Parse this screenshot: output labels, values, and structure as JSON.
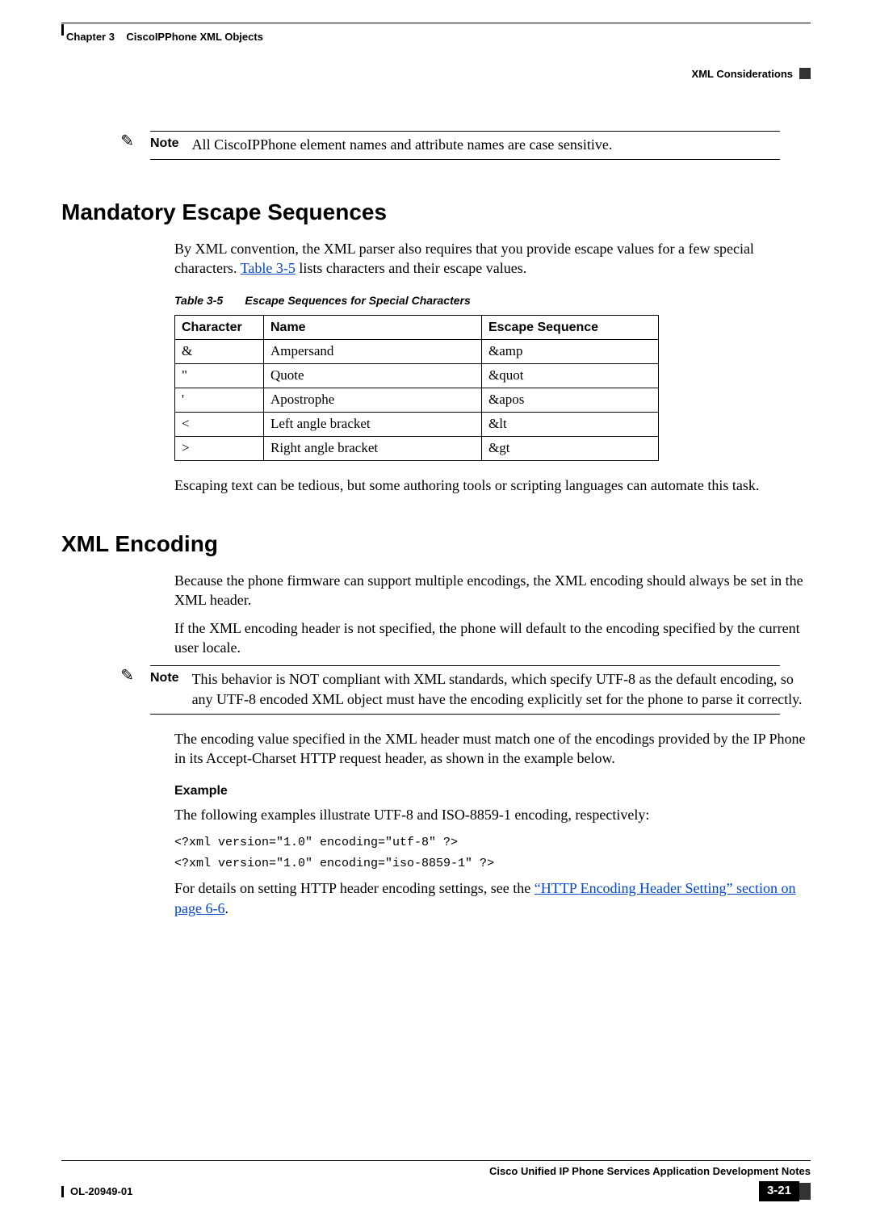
{
  "header": {
    "chapter_label": "Chapter 3",
    "chapter_title": "CiscoIPPhone XML Objects",
    "right_sub": "XML Considerations"
  },
  "note1": {
    "label": "Note",
    "text": "All CiscoIPPhone element names and attribute names are case sensitive."
  },
  "section1": {
    "heading": "Mandatory Escape Sequences",
    "intro_pre": "By XML convention, the XML parser also requires that you provide escape values for a few special characters. ",
    "intro_link": "Table 3-5",
    "intro_post": " lists characters and their escape values.",
    "table_caption_a": "Table 3-5",
    "table_caption_b": "Escape Sequences for Special Characters",
    "cols": {
      "c1": "Character",
      "c2": "Name",
      "c3": "Escape Sequence"
    },
    "rows": [
      {
        "char": "&",
        "name": "Ampersand",
        "seq": "&amp"
      },
      {
        "char": "\"",
        "name": "Quote",
        "seq": "&quot"
      },
      {
        "char": "'",
        "name": "Apostrophe",
        "seq": "&apos"
      },
      {
        "char": "<",
        "name": "Left angle bracket",
        "seq": "&lt"
      },
      {
        "char": ">",
        "name": "Right angle bracket",
        "seq": "&gt"
      }
    ],
    "outro": "Escaping text can be tedious, but some authoring tools or scripting languages can automate this task."
  },
  "section2": {
    "heading": "XML Encoding",
    "p1": "Because the phone firmware can support multiple encodings, the XML encoding should always be set in the XML header.",
    "p2": "If the XML encoding header is not specified, the phone will default to the encoding specified by the current user locale.",
    "note": {
      "label": "Note",
      "text": "This behavior is NOT compliant with XML standards, which specify UTF-8 as the default encoding, so any UTF-8 encoded XML object must have the encoding explicitly set for the phone to parse it correctly."
    },
    "p3": "The encoding value specified in the XML header must match one of the encodings provided by the IP Phone in its Accept-Charset HTTP request header, as shown in the example below.",
    "example_label": "Example",
    "example_intro": "The following examples illustrate UTF-8 and ISO-8859-1 encoding, respectively:",
    "code": "<?xml version=\"1.0\" encoding=\"utf-8\" ?>\n<?xml version=\"1.0\" encoding=\"iso-8859-1\" ?>",
    "p4_pre": "For details on setting HTTP header encoding settings, see the ",
    "p4_link": "“HTTP Encoding Header Setting” section on page 6-6",
    "p4_post": "."
  },
  "footer": {
    "book": "Cisco Unified IP Phone Services Application Development Notes",
    "docnum": "OL-20949-01",
    "page": "3-21"
  }
}
